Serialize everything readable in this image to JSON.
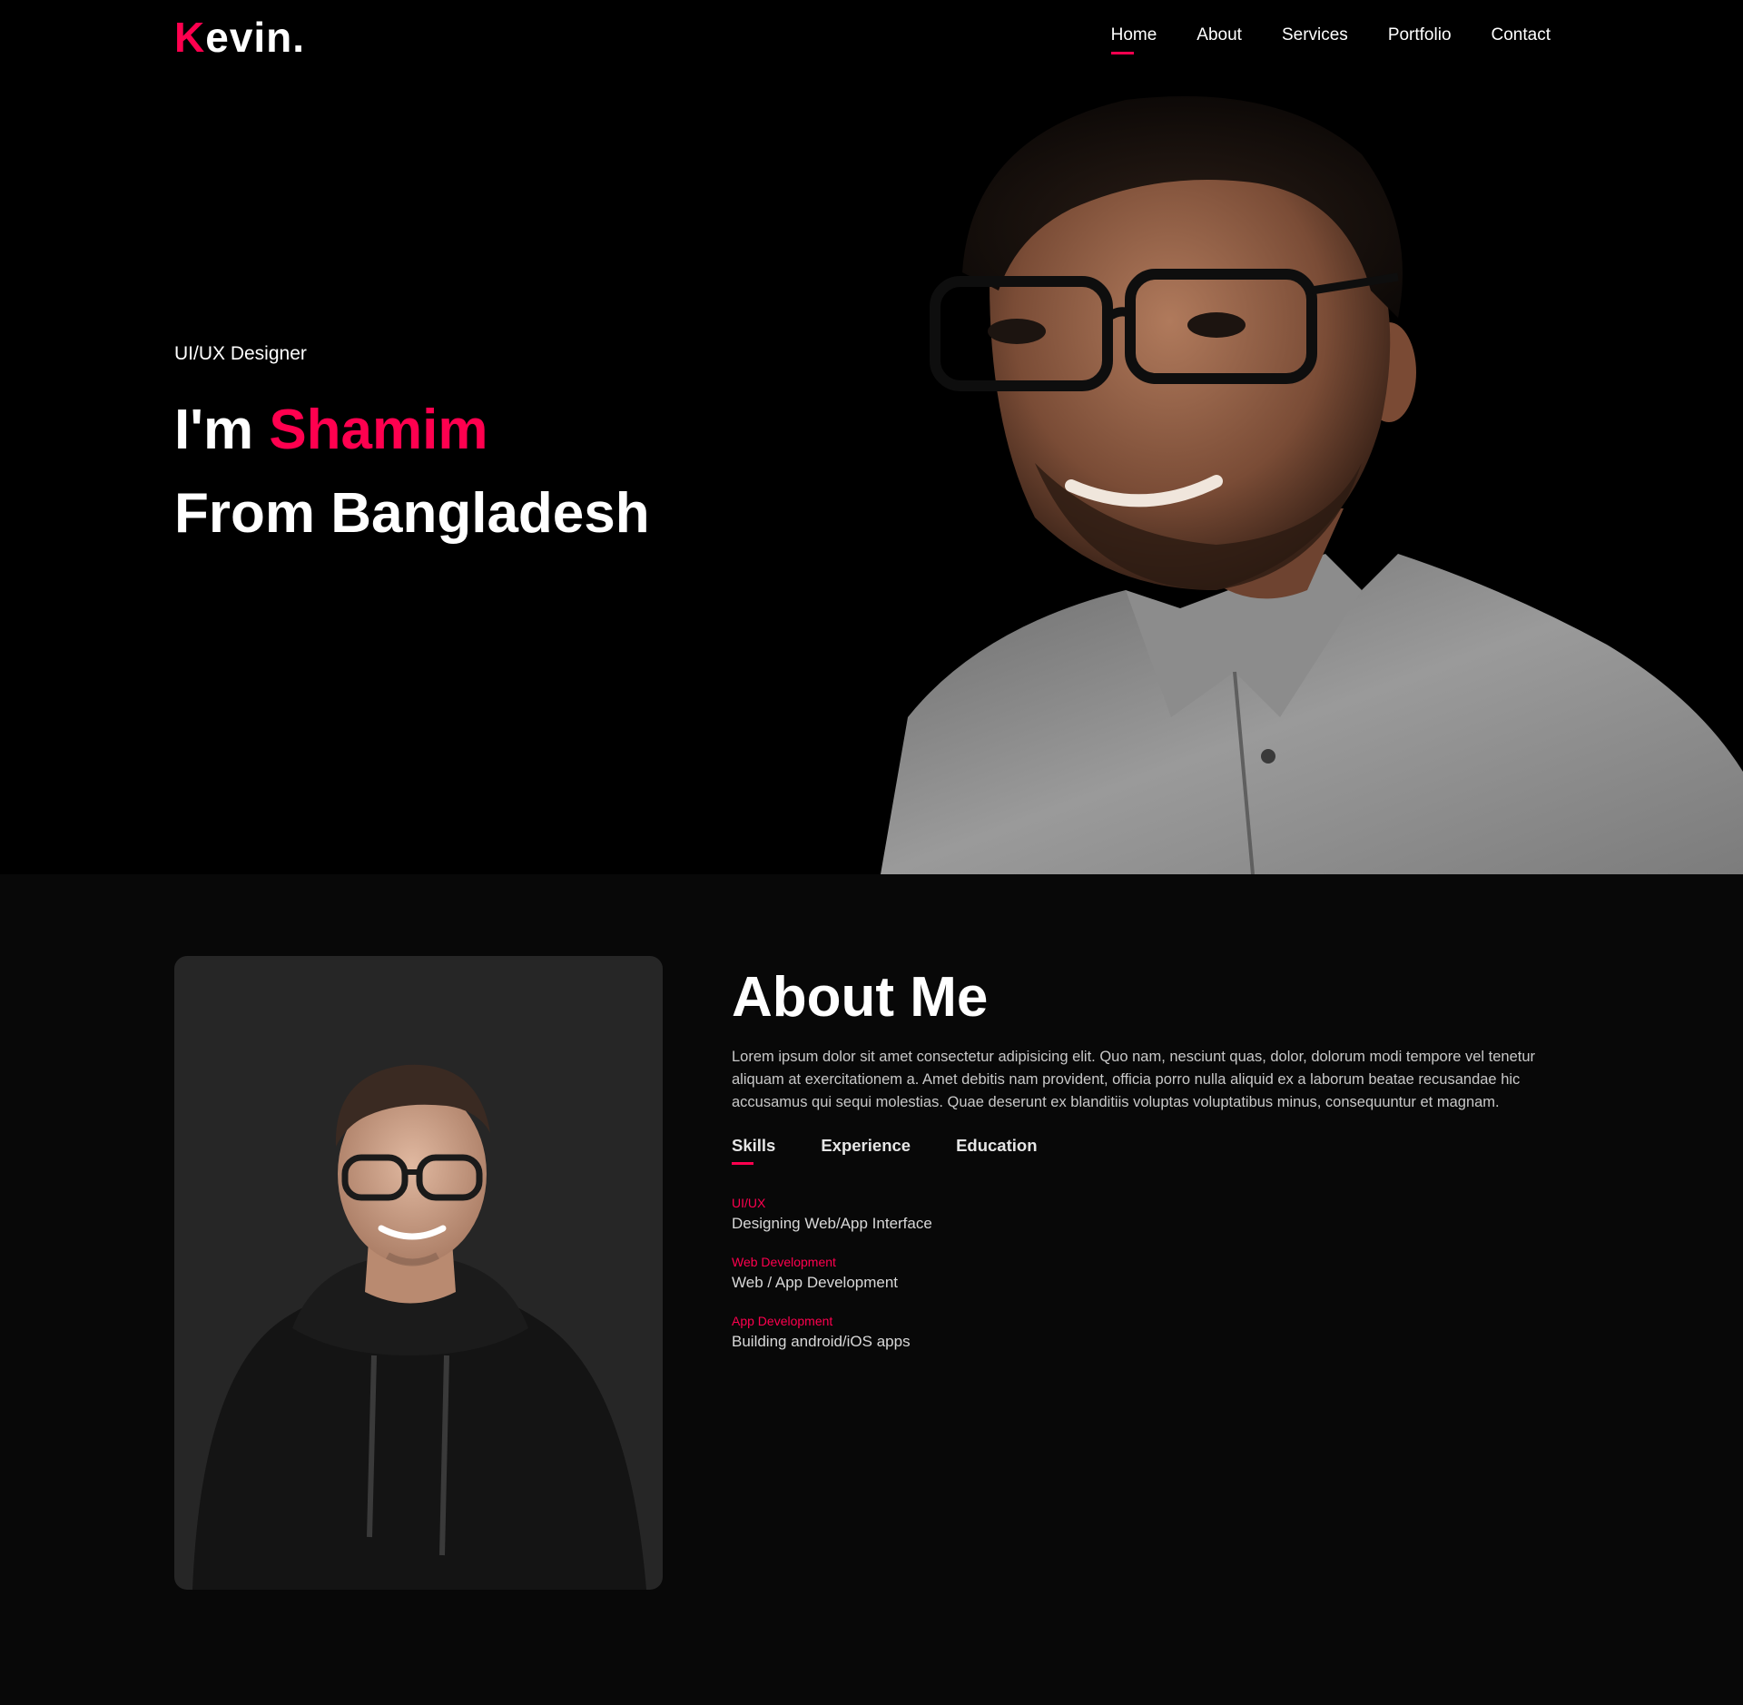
{
  "brand": {
    "logo_first": "K",
    "logo_rest": "evin.",
    "accent_color": "#ff004f"
  },
  "nav": {
    "items": [
      {
        "label": "Home",
        "active": true
      },
      {
        "label": "About",
        "active": false
      },
      {
        "label": "Services",
        "active": false
      },
      {
        "label": "Portfolio",
        "active": false
      },
      {
        "label": "Contact",
        "active": false
      }
    ]
  },
  "hero": {
    "subtitle": "UI/UX Designer",
    "line1_prefix": "I'm ",
    "line1_name": "Shamim",
    "line2": "From Bangladesh"
  },
  "about": {
    "title": "About Me",
    "description": "Lorem ipsum dolor sit amet consectetur adipisicing elit. Quo nam, nesciunt quas, dolor, dolorum modi tempore vel tenetur aliquam at exercitationem a. Amet debitis nam provident, officia porro nulla aliquid ex a laborum beatae recusandae hic accusamus qui sequi molestias. Quae deserunt ex blanditiis voluptas voluptatibus minus, consequuntur et magnam.",
    "tabs": [
      {
        "label": "Skills",
        "active": true
      },
      {
        "label": "Experience",
        "active": false
      },
      {
        "label": "Education",
        "active": false
      }
    ],
    "skills": [
      {
        "category": "UI/UX",
        "description": "Designing Web/App Interface"
      },
      {
        "category": "Web Development",
        "description": "Web / App Development"
      },
      {
        "category": "App Development",
        "description": "Building android/iOS apps"
      }
    ]
  }
}
